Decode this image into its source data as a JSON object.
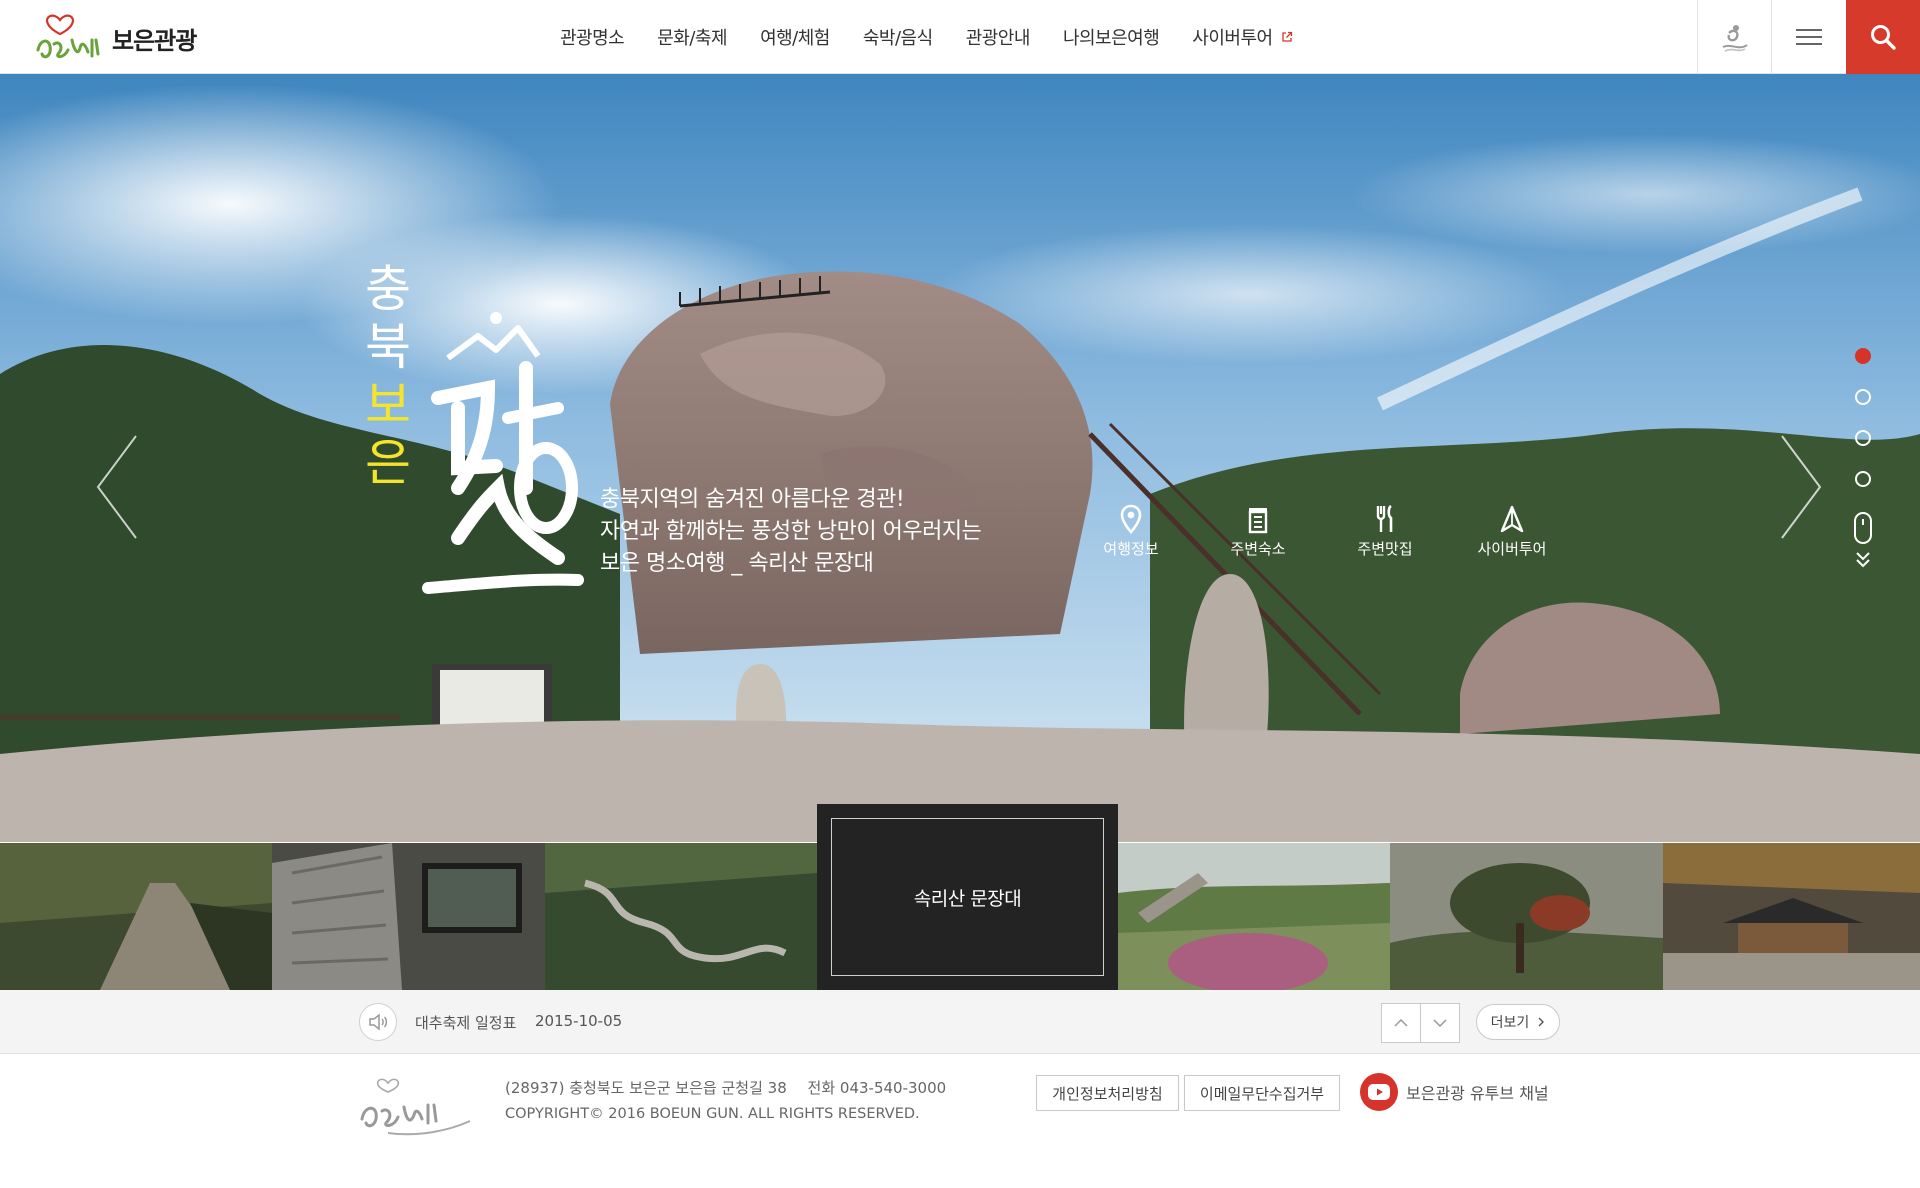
{
  "header": {
    "logo_text": "보은관광",
    "nav": [
      "관광명소",
      "문화/축제",
      "여행/체험",
      "숙박/음식",
      "관광안내",
      "나의보은여행",
      "사이버투어"
    ]
  },
  "hero": {
    "vertical_title": [
      "충",
      "북"
    ],
    "vertical_highlight": [
      "보",
      "은"
    ],
    "description": [
      "충북지역의 숨겨진 아름다운 경관!",
      "자연과 함께하는 풍성한 낭만이 어우러지는",
      "보은 명소여행 _ 속리산 문장대"
    ],
    "quick_links": [
      "여행정보",
      "주변숙소",
      "주변맛집",
      "사이버투어"
    ],
    "slide_count": 4,
    "active_slide": 1
  },
  "thumbnails": {
    "active_label": "속리산 문장대"
  },
  "notice": {
    "title": "대추축제 일정표",
    "date": "2015-10-05",
    "more_label": "더보기"
  },
  "footer": {
    "address": "(28937) 충청북도 보은군 보은읍 군청길 38",
    "tel": "전화 043-540-3000",
    "copyright": "COPYRIGHT© 2016 BOEUN GUN. ALL RIGHTS RESERVED.",
    "privacy_label": "개인정보처리방침",
    "email_label": "이메일무단수집거부",
    "youtube_label": "보은관광 유투브 채널"
  },
  "colors": {
    "accent": "#d6332a",
    "highlight": "#f4e42b"
  }
}
